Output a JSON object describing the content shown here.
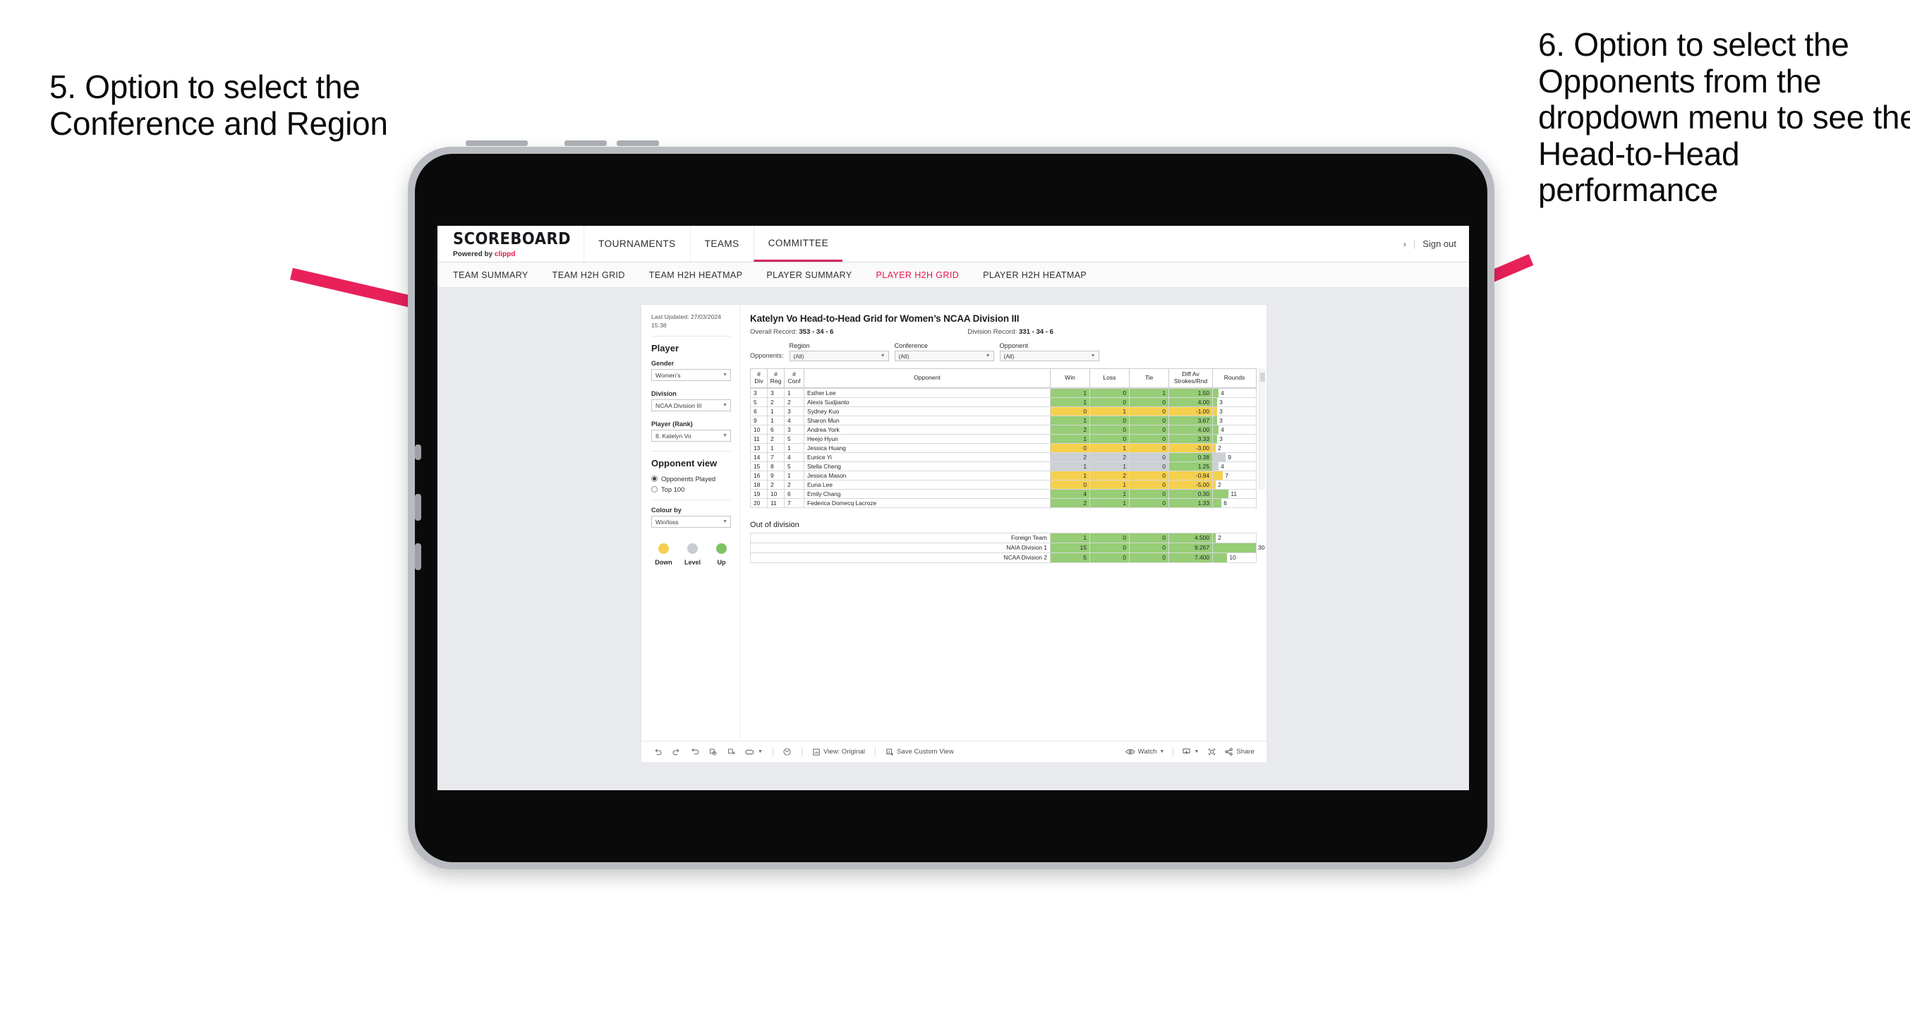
{
  "annotations": {
    "left": "5. Option to select the Conference and Region",
    "right": "6. Option to select the Opponents from the dropdown menu to see the Head-to-Head performance"
  },
  "topnav": {
    "brand_name": "SCOREBOARD",
    "brand_powered": "Powered by",
    "brand_clippd": "clippd",
    "items": [
      {
        "label": "TOURNAMENTS",
        "active": false
      },
      {
        "label": "TEAMS",
        "active": false
      },
      {
        "label": "COMMITTEE",
        "active": true
      }
    ],
    "chevron": "›",
    "separator": "|",
    "sign_out": "Sign out"
  },
  "subnav": {
    "items": [
      {
        "label": "TEAM SUMMARY",
        "active": false
      },
      {
        "label": "TEAM H2H GRID",
        "active": false
      },
      {
        "label": "TEAM H2H HEATMAP",
        "active": false
      },
      {
        "label": "PLAYER SUMMARY",
        "active": false
      },
      {
        "label": "PLAYER H2H GRID",
        "active": true
      },
      {
        "label": "PLAYER H2H HEATMAP",
        "active": false
      }
    ]
  },
  "sidebar": {
    "last_updated": "Last Updated: 27/03/2024 15:38",
    "player_heading": "Player",
    "gender_label": "Gender",
    "gender_value": "Women’s",
    "division_label": "Division",
    "division_value": "NCAA Division III",
    "player_rank_label": "Player (Rank)",
    "player_rank_value": "8. Katelyn Vo",
    "opponent_view_heading": "Opponent view",
    "opponent_view_options": [
      {
        "label": "Opponents Played",
        "selected": true
      },
      {
        "label": "Top 100",
        "selected": false
      }
    ],
    "colour_by_label": "Colour by",
    "colour_by_value": "Win/loss",
    "legend": [
      {
        "label": "Down",
        "color": "#f5d04e"
      },
      {
        "label": "Level",
        "color": "#c9cdd2"
      },
      {
        "label": "Up",
        "color": "#7dc462"
      }
    ]
  },
  "viz": {
    "title": "Katelyn Vo Head-to-Head Grid for Women’s NCAA Division III",
    "overall_record_label": "Overall Record:",
    "overall_record_value": "353 - 34 - 6",
    "division_record_label": "Division Record:",
    "division_record_value": "331 -  34 - 6",
    "opponents_label": "Opponents:",
    "filters": [
      {
        "name": "region",
        "label": "Region",
        "value": "(All)"
      },
      {
        "name": "conference",
        "label": "Conference",
        "value": "(All)"
      },
      {
        "name": "opponent",
        "label": "Opponent",
        "value": "(All)"
      }
    ],
    "columns": [
      "# Div",
      "# Reg",
      "# Conf",
      "Opponent",
      "Win",
      "Loss",
      "Tie",
      "Diff Av Strokes/Rnd",
      "Rounds"
    ],
    "column_headers": [
      {
        "top": "#",
        "bottom": "Div"
      },
      {
        "top": "#",
        "bottom": "Reg"
      },
      {
        "top": "#",
        "bottom": "Conf"
      },
      {
        "top": "Opponent",
        "bottom": ""
      },
      {
        "top": "Win",
        "bottom": ""
      },
      {
        "top": "Loss",
        "bottom": ""
      },
      {
        "top": "Tie",
        "bottom": ""
      },
      {
        "top": "Diff Av",
        "bottom": "Strokes/Rnd"
      },
      {
        "top": "Rounds",
        "bottom": ""
      }
    ],
    "rounds_max": 30,
    "rows": [
      {
        "div": "3",
        "reg": "3",
        "conf": "1",
        "opponent": "Esther Lee",
        "win": "1",
        "loss": "0",
        "tie": "1",
        "diff": "1.50",
        "rounds": 4,
        "state": "win"
      },
      {
        "div": "5",
        "reg": "2",
        "conf": "2",
        "opponent": "Alexis Sudjianto",
        "win": "1",
        "loss": "0",
        "tie": "0",
        "diff": "4.00",
        "rounds": 3,
        "state": "win"
      },
      {
        "div": "6",
        "reg": "1",
        "conf": "3",
        "opponent": "Sydney Kuo",
        "win": "0",
        "loss": "1",
        "tie": "0",
        "diff": "-1.00",
        "rounds": 3,
        "state": "lose"
      },
      {
        "div": "9",
        "reg": "1",
        "conf": "4",
        "opponent": "Sharon Mun",
        "win": "1",
        "loss": "0",
        "tie": "0",
        "diff": "3.67",
        "rounds": 3,
        "state": "win"
      },
      {
        "div": "10",
        "reg": "6",
        "conf": "3",
        "opponent": "Andrea York",
        "win": "2",
        "loss": "0",
        "tie": "0",
        "diff": "4.00",
        "rounds": 4,
        "state": "win"
      },
      {
        "div": "11",
        "reg": "2",
        "conf": "5",
        "opponent": "Heejo Hyun",
        "win": "1",
        "loss": "0",
        "tie": "0",
        "diff": "3.33",
        "rounds": 3,
        "state": "win"
      },
      {
        "div": "13",
        "reg": "1",
        "conf": "1",
        "opponent": "Jessica Huang",
        "win": "0",
        "loss": "1",
        "tie": "0",
        "diff": "-3.00",
        "rounds": 2,
        "state": "lose"
      },
      {
        "div": "14",
        "reg": "7",
        "conf": "4",
        "opponent": "Eunice Yi",
        "win": "2",
        "loss": "2",
        "tie": "0",
        "diff": "0.38",
        "rounds": 9,
        "state": "level",
        "diff_state": "win"
      },
      {
        "div": "15",
        "reg": "8",
        "conf": "5",
        "opponent": "Stella Cheng",
        "win": "1",
        "loss": "1",
        "tie": "0",
        "diff": "1.25",
        "rounds": 4,
        "state": "level",
        "diff_state": "win"
      },
      {
        "div": "16",
        "reg": "9",
        "conf": "1",
        "opponent": "Jessica Mason",
        "win": "1",
        "loss": "2",
        "tie": "0",
        "diff": "-0.94",
        "rounds": 7,
        "state": "lose"
      },
      {
        "div": "18",
        "reg": "2",
        "conf": "2",
        "opponent": "Euna Lee",
        "win": "0",
        "loss": "1",
        "tie": "0",
        "diff": "-5.00",
        "rounds": 2,
        "state": "lose"
      },
      {
        "div": "19",
        "reg": "10",
        "conf": "6",
        "opponent": "Emily Chang",
        "win": "4",
        "loss": "1",
        "tie": "0",
        "diff": "0.30",
        "rounds": 11,
        "state": "win"
      },
      {
        "div": "20",
        "reg": "11",
        "conf": "7",
        "opponent": "Federica Domecq Lacroze",
        "win": "2",
        "loss": "1",
        "tie": "0",
        "diff": "1.33",
        "rounds": 6,
        "state": "win"
      }
    ],
    "out_of_division_title": "Out of division",
    "out_of_division_rows": [
      {
        "name": "Foreign Team",
        "win": "1",
        "loss": "0",
        "tie": "0",
        "diff": "4.500",
        "rounds": 2,
        "state": "win"
      },
      {
        "name": "NAIA Division 1",
        "win": "15",
        "loss": "0",
        "tie": "0",
        "diff": "9.267",
        "rounds": 30,
        "state": "win"
      },
      {
        "name": "NCAA Division 2",
        "win": "5",
        "loss": "0",
        "tie": "0",
        "diff": "7.400",
        "rounds": 10,
        "state": "win"
      }
    ]
  },
  "toolbar": {
    "view_label": "View: Original",
    "save_label": "Save Custom View",
    "watch_label": "Watch",
    "share_label": "Share"
  },
  "colors": {
    "accent": "#e8174b",
    "tab_underline": "#d4265c",
    "win": "#97cd76",
    "lose": "#f5d04e",
    "level": "#cdd0d4",
    "arrow": "#e8215b"
  }
}
